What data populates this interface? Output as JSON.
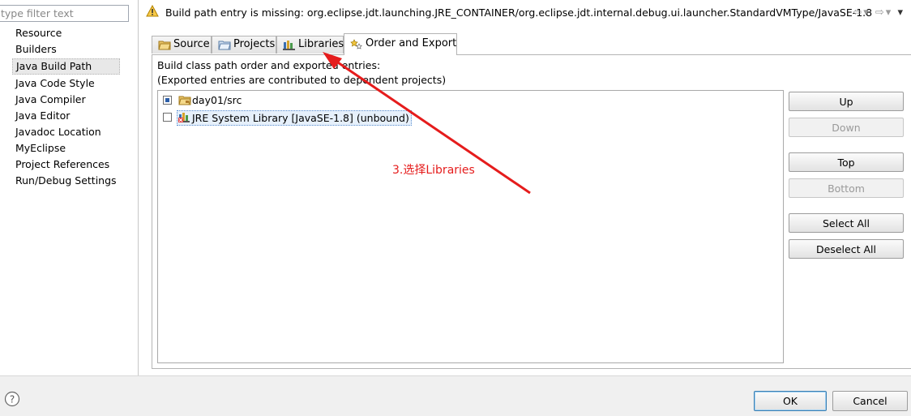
{
  "filter": {
    "placeholder": "type filter text"
  },
  "nav": {
    "items": [
      "Resource",
      "Builders",
      "Java Build Path",
      "Java Code Style",
      "Java Compiler",
      "Java Editor",
      "Javadoc Location",
      "MyEclipse",
      "Project References",
      "Run/Debug Settings"
    ],
    "selected": "Java Build Path"
  },
  "header": {
    "message": "Build path entry is missing: org.eclipse.jdt.launching.JRE_CONTAINER/org.eclipse.jdt.internal.debug.ui.launcher.StandardVMType/JavaSE-1.8",
    "icons": [
      "warning-icon",
      "back-arrow-icon",
      "forward-arrow-icon",
      "dropdown-icon"
    ]
  },
  "tabs": [
    {
      "label": "Source",
      "icon": "source-folder-icon"
    },
    {
      "label": "Projects",
      "icon": "projects-icon"
    },
    {
      "label": "Libraries",
      "icon": "libraries-icon"
    },
    {
      "label": "Order and Export",
      "icon": "order-export-icon",
      "active": true
    }
  ],
  "panel": {
    "line1": "Build class path order and exported entries:",
    "line2": "(Exported entries are contributed to dependent projects)"
  },
  "entries": [
    {
      "label": "day01/src",
      "checked": true,
      "icon": "package-folder-icon"
    },
    {
      "label": "JRE System Library [JavaSE-1.8] (unbound)",
      "checked": false,
      "icon": "jre-library-icon",
      "selected": true
    }
  ],
  "buttons": {
    "up": "Up",
    "down": "Down",
    "top": "Top",
    "bottom": "Bottom",
    "select_all": "Select All",
    "deselect_all": "Deselect All"
  },
  "annotation": {
    "text": "3.选择Libraries",
    "color": "#e51c1c"
  },
  "footer": {
    "ok": "OK",
    "cancel": "Cancel",
    "icon": "help-icon"
  }
}
